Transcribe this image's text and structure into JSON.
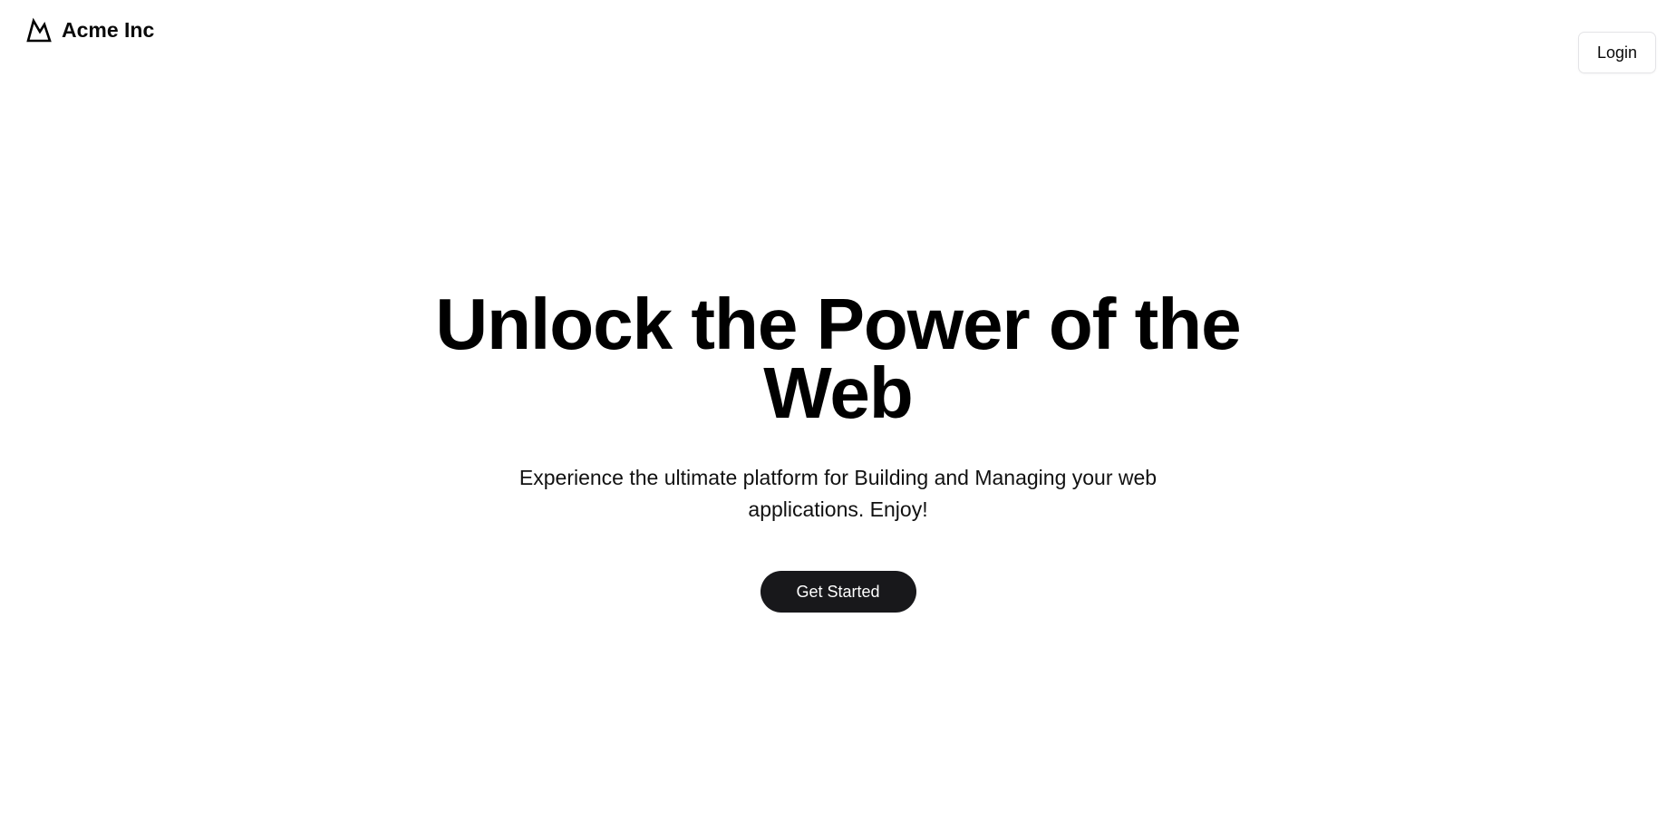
{
  "header": {
    "brand_name": "Acme Inc",
    "brand_icon": "mountain-icon",
    "login_label": "Login"
  },
  "hero": {
    "title": "Unlock the Power of the Web",
    "subtitle": "Experience the ultimate platform for Building and Managing your web applications. Enjoy!",
    "cta_label": "Get Started"
  },
  "colors": {
    "background": "#ffffff",
    "text": "#000000",
    "cta_background": "#18181b",
    "cta_text": "#ffffff",
    "login_border": "#e4e4e7"
  }
}
